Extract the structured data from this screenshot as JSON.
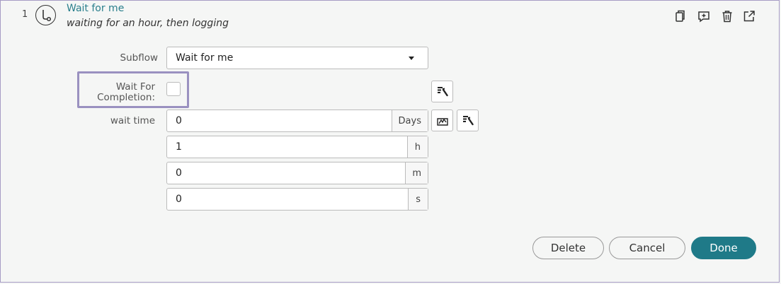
{
  "step": {
    "number": "1",
    "title": "Wait for me",
    "description": "waiting for an hour, then logging",
    "icon": "subflow-icon"
  },
  "toolbar": {
    "icons": [
      "copy-icon",
      "add-comment-icon",
      "trash-icon",
      "open-external-icon"
    ]
  },
  "form": {
    "subflow": {
      "label": "Subflow",
      "value": "Wait for me"
    },
    "wait_for_completion": {
      "label_line1": "Wait For",
      "label_line2": "Completion:",
      "checked": false
    },
    "wait_time": {
      "label": "wait time",
      "fields": [
        {
          "value": "0",
          "unit": "Days"
        },
        {
          "value": "1",
          "unit": "h"
        },
        {
          "value": "0",
          "unit": "m"
        },
        {
          "value": "0",
          "unit": "s"
        }
      ]
    }
  },
  "actions": {
    "delete": "Delete",
    "cancel": "Cancel",
    "done": "Done"
  },
  "colors": {
    "accent": "#1f7a88",
    "title": "#2a7f8c",
    "highlight": "#9a91c0"
  }
}
